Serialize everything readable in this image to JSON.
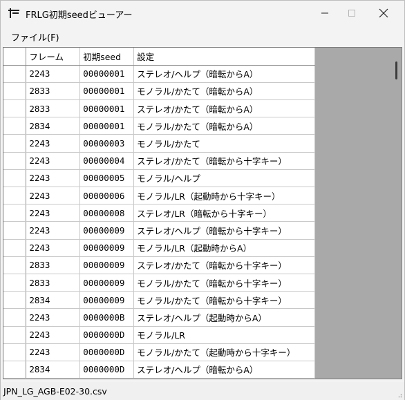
{
  "window": {
    "title": "FRLG初期seedビューアー"
  },
  "menu": {
    "items": [
      {
        "label": "ファイル(F)"
      }
    ]
  },
  "table": {
    "columns": [
      "フレーム",
      "初期seed",
      "設定"
    ],
    "rows": [
      {
        "frame": "2243",
        "seed": "00000001",
        "setting": "ステレオ/ヘルプ（暗転からA）"
      },
      {
        "frame": "2833",
        "seed": "00000001",
        "setting": "モノラル/かたて（暗転からA）"
      },
      {
        "frame": "2833",
        "seed": "00000001",
        "setting": "ステレオ/かたて（暗転からA）"
      },
      {
        "frame": "2834",
        "seed": "00000001",
        "setting": "モノラル/かたて（暗転からA）"
      },
      {
        "frame": "2243",
        "seed": "00000003",
        "setting": "モノラル/かたて"
      },
      {
        "frame": "2243",
        "seed": "00000004",
        "setting": "ステレオ/かたて（暗転から十字キー）"
      },
      {
        "frame": "2243",
        "seed": "00000005",
        "setting": "モノラル/ヘルプ"
      },
      {
        "frame": "2243",
        "seed": "00000006",
        "setting": "モノラル/LR（起動時から十字キー）"
      },
      {
        "frame": "2243",
        "seed": "00000008",
        "setting": "ステレオ/LR（暗転から十字キー）"
      },
      {
        "frame": "2243",
        "seed": "00000009",
        "setting": "ステレオ/ヘルプ（暗転から十字キー）"
      },
      {
        "frame": "2243",
        "seed": "00000009",
        "setting": "モノラル/LR（起動時からA）"
      },
      {
        "frame": "2833",
        "seed": "00000009",
        "setting": "ステレオ/かたて（暗転から十字キー）"
      },
      {
        "frame": "2833",
        "seed": "00000009",
        "setting": "モノラル/かたて（暗転から十字キー）"
      },
      {
        "frame": "2834",
        "seed": "00000009",
        "setting": "モノラル/かたて（暗転から十字キー）"
      },
      {
        "frame": "2243",
        "seed": "0000000B",
        "setting": "ステレオ/ヘルプ（起動時からA）"
      },
      {
        "frame": "2243",
        "seed": "0000000D",
        "setting": "モノラル/LR"
      },
      {
        "frame": "2243",
        "seed": "0000000D",
        "setting": "モノラル/かたて（起動時から十字キー）"
      },
      {
        "frame": "2834",
        "seed": "0000000D",
        "setting": "ステレオ/ヘルプ（暗転からA）"
      }
    ]
  },
  "status": {
    "text": "JPN_LG_AGB-E02-30.csv"
  },
  "icons": {
    "app": "app-icon",
    "minimize": "minimize-icon",
    "maximize": "maximize-icon",
    "close": "close-icon",
    "grip": "resize-grip-icon"
  }
}
